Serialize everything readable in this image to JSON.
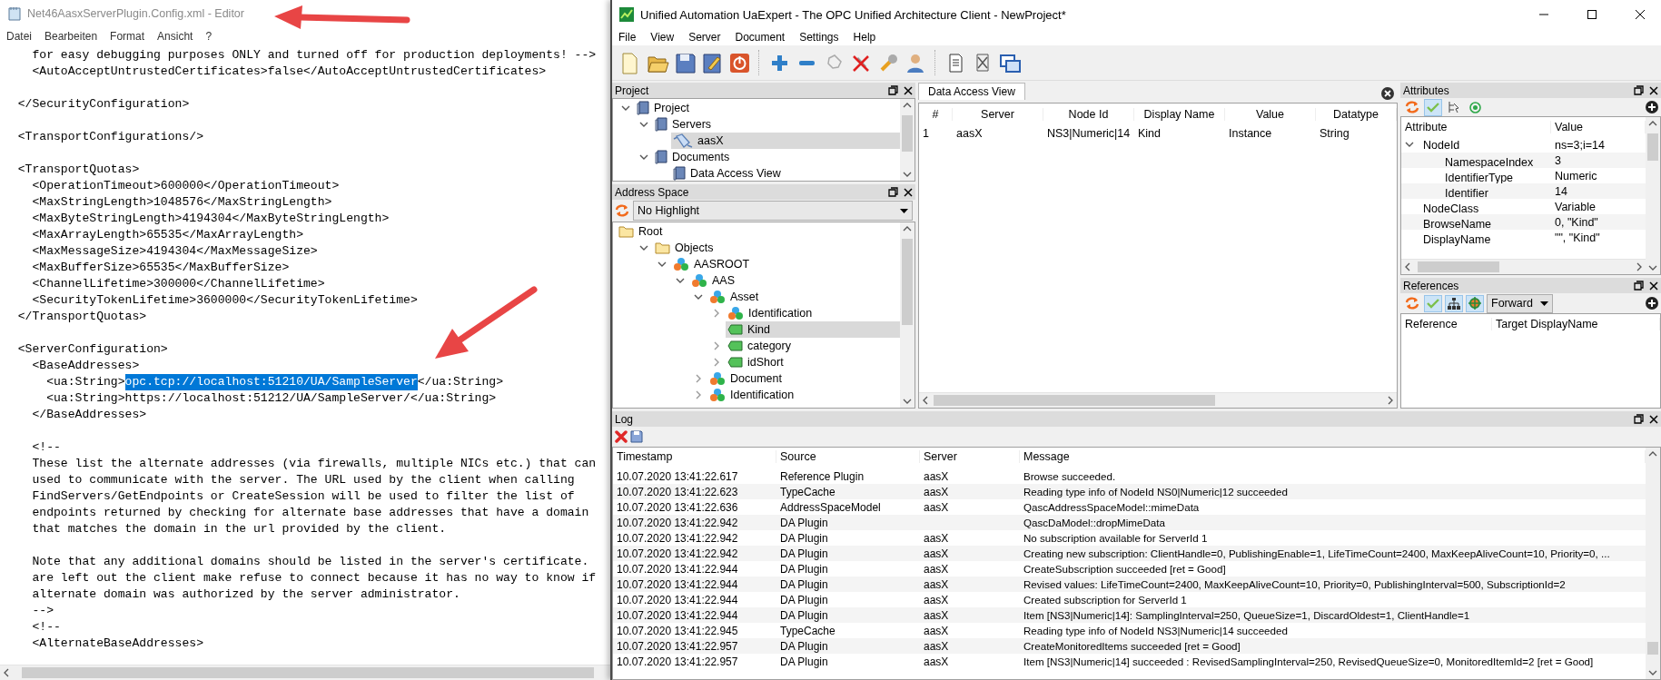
{
  "editor": {
    "title": "Net46AasxServerPlugin.Config.xml - Editor",
    "menu": [
      "Datei",
      "Bearbeiten",
      "Format",
      "Ansicht",
      "?"
    ],
    "blocks": [
      [
        "    for easy debugging purposes ONLY and turned off for production deployments! -->",
        "    <AutoAcceptUntrustedCertificates>false</AutoAcceptUntrustedCertificates>"
      ],
      [
        "  </SecurityConfiguration>"
      ],
      [
        "  <TransportConfigurations/>"
      ],
      [
        "  <TransportQuotas>",
        "    <OperationTimeout>600000</OperationTimeout>",
        "    <MaxStringLength>1048576</MaxStringLength>",
        "    <MaxByteStringLength>4194304</MaxByteStringLength>",
        "    <MaxArrayLength>65535</MaxArrayLength>",
        "    <MaxMessageSize>4194304</MaxMessageSize>",
        "    <MaxBufferSize>65535</MaxBufferSize>",
        "    <ChannelLifetime>300000</ChannelLifetime>",
        "    <SecurityTokenLifetime>3600000</SecurityTokenLifetime>",
        "  </TransportQuotas>"
      ],
      [
        "  <ServerConfiguration>",
        "    <BaseAddresses>",
        {
          "segments": [
            {
              "text": "      <ua:String>",
              "selected": false
            },
            {
              "text": "opc.tcp://localhost:51210/UA/SampleServer",
              "selected": true
            },
            {
              "text": "</ua:String>",
              "selected": false
            }
          ]
        },
        "      <ua:String>https://localhost:51212/UA/SampleServer/</ua:String>",
        "    </BaseAddresses>"
      ],
      [
        "    <!--",
        "    These list the alternate addresses (via firewalls, multiple NICs etc.) that can",
        "    used to communicate with the server. The URL used by the client when calling",
        "    FindServers/GetEndpoints or CreateSession will be used to filter the list of",
        "    endpoints returned by checking for alternate base addresses that have a domain",
        "    that matches the domain in the url provided by the client."
      ],
      [
        "    Note that any additional domains should be listed in the server's certificate.",
        "    are left out the client make refuse to connect because it has no way to know if",
        "    alternate domain was authorized by the server administrator.",
        "    -->",
        "    <!--",
        "    <AlternateBaseAddresses>"
      ]
    ]
  },
  "uaexpert": {
    "title": "Unified Automation UaExpert - The OPC Unified Architecture Client - NewProject*",
    "menu": [
      "File",
      "View",
      "Server",
      "Document",
      "Settings",
      "Help"
    ],
    "project": {
      "title": "Project",
      "tree": [
        {
          "label": "Project",
          "kind": "book",
          "expanded": true,
          "selected": false,
          "children": [
            {
              "label": "Servers",
              "kind": "book",
              "expanded": true,
              "selected": false,
              "children": [
                {
                  "label": "aasX",
                  "kind": "server",
                  "selected": true
                }
              ]
            },
            {
              "label": "Documents",
              "kind": "book",
              "expanded": true,
              "selected": false,
              "children": [
                {
                  "label": "Data Access View",
                  "kind": "book",
                  "selected": false
                }
              ]
            }
          ]
        }
      ]
    },
    "address_space": {
      "title": "Address Space",
      "highlight": "No Highlight",
      "tree": [
        {
          "label": "Root",
          "kind": "folder",
          "selected": false,
          "children": [
            {
              "label": "Objects",
              "kind": "folder",
              "expanded": true,
              "selected": false,
              "children": [
                {
                  "label": "AASROOT",
                  "kind": "object",
                  "expanded": true,
                  "selected": false,
                  "children": [
                    {
                      "label": "AAS",
                      "kind": "object",
                      "expanded": true,
                      "selected": false,
                      "children": [
                        {
                          "label": "Asset",
                          "kind": "object",
                          "expanded": true,
                          "selected": false,
                          "children": [
                            {
                              "label": "Identification",
                              "kind": "object",
                              "expanded": false,
                              "selected": false
                            },
                            {
                              "label": "Kind",
                              "kind": "variable",
                              "selected": true
                            },
                            {
                              "label": "category",
                              "kind": "variable",
                              "expanded": false,
                              "selected": false
                            },
                            {
                              "label": "idShort",
                              "kind": "variable",
                              "expanded": false,
                              "selected": false
                            }
                          ]
                        },
                        {
                          "label": "Document",
                          "kind": "object",
                          "expanded": false,
                          "selected": false
                        },
                        {
                          "label": "Identification",
                          "kind": "object",
                          "expanded": false,
                          "selected": false
                        }
                      ]
                    }
                  ]
                }
              ]
            }
          ]
        }
      ]
    },
    "data_access": {
      "tab": "Data Access View",
      "columns": [
        "#",
        "Server",
        "Node Id",
        "Display Name",
        "Value",
        "Datatype"
      ],
      "rows": [
        [
          "1",
          "aasX",
          "NS3|Numeric|14",
          "Kind",
          "Instance",
          "String"
        ]
      ]
    },
    "attributes": {
      "title": "Attributes",
      "columns": [
        "Attribute",
        "Value"
      ],
      "rows": [
        {
          "attribute": "NodeId",
          "value": "ns=3;i=14",
          "expanded": true,
          "children": [
            {
              "attribute": "NamespaceIndex",
              "value": "3"
            },
            {
              "attribute": "IdentifierType",
              "value": "Numeric"
            },
            {
              "attribute": "Identifier",
              "value": "14"
            }
          ]
        },
        {
          "attribute": "NodeClass",
          "value": "Variable"
        },
        {
          "attribute": "BrowseName",
          "value": "0, \"Kind\""
        },
        {
          "attribute": "DisplayName",
          "value": "\"\", \"Kind\""
        }
      ]
    },
    "references": {
      "title": "References",
      "direction": "Forward",
      "columns": [
        "Reference",
        "Target DisplayName"
      ]
    },
    "log": {
      "title": "Log",
      "columns": [
        "Timestamp",
        "Source",
        "Server",
        "Message"
      ],
      "rows": [
        {
          "timestamp": "10.07.2020 13:41:22.617",
          "source": "Reference Plugin",
          "server": "aasX",
          "message": "Browse succeeded."
        },
        {
          "timestamp": "10.07.2020 13:41:22.623",
          "source": "TypeCache",
          "server": "aasX",
          "message": "Reading type info of NodeId NS0|Numeric|12 succeeded"
        },
        {
          "timestamp": "10.07.2020 13:41:22.636",
          "source": "AddressSpaceModel",
          "server": "aasX",
          "message": "QascAddressSpaceModel::mimeData"
        },
        {
          "timestamp": "10.07.2020 13:41:22.942",
          "source": "DA Plugin",
          "message": "QascDaModel::dropMimeData"
        },
        {
          "timestamp": "10.07.2020 13:41:22.942",
          "source": "DA Plugin",
          "server": "aasX",
          "message": "No subscription available for ServerId 1"
        },
        {
          "timestamp": "10.07.2020 13:41:22.942",
          "source": "DA Plugin",
          "server": "aasX",
          "message": "Creating new subscription: ClientHandle=0, PublishingEnable=1, LifeTimeCount=2400, MaxKeepAliveCount=10, Priority=0, ..."
        },
        {
          "timestamp": "10.07.2020 13:41:22.944",
          "source": "DA Plugin",
          "server": "aasX",
          "message": "CreateSubscription succeeded [ret = Good]"
        },
        {
          "timestamp": "10.07.2020 13:41:22.944",
          "source": "DA Plugin",
          "server": "aasX",
          "message": "Revised values: LifeTimeCount=2400, MaxKeepAliveCount=10, Priority=0, PublishingInterval=500, SubscriptionId=2"
        },
        {
          "timestamp": "10.07.2020 13:41:22.944",
          "source": "DA Plugin",
          "server": "aasX",
          "message": "Created subscription for ServerId 1"
        },
        {
          "timestamp": "10.07.2020 13:41:22.944",
          "source": "DA Plugin",
          "server": "aasX",
          "message": "Item [NS3|Numeric|14]: SamplingInterval=250, QueueSize=1, DiscardOldest=1, ClientHandle=1"
        },
        {
          "timestamp": "10.07.2020 13:41:22.945",
          "source": "TypeCache",
          "server": "aasX",
          "message": "Reading type info of NodeId NS3|Numeric|14 succeeded"
        },
        {
          "timestamp": "10.07.2020 13:41:22.957",
          "source": "DA Plugin",
          "server": "aasX",
          "message": "CreateMonitoredItems succeeded [ret = Good]"
        },
        {
          "timestamp": "10.07.2020 13:41:22.957",
          "source": "DA Plugin",
          "server": "aasX",
          "message": "Item [NS3|Numeric|14] succeeded : RevisedSamplingInterval=250, RevisedQueueSize=0, MonitoredItemId=2 [ret = Good]"
        }
      ]
    }
  }
}
